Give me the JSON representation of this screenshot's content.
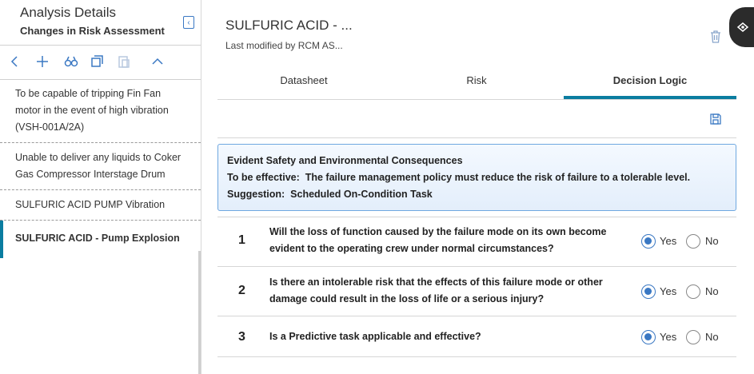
{
  "sidebar": {
    "title": "Analysis Details",
    "subtitle": "Changes in Risk Assessment",
    "items": [
      {
        "label": "To be capable of tripping Fin Fan motor in the event of high vibration (VSH-001A/2A)"
      },
      {
        "label": "Unable to deliver any liquids to Coker Gas Compressor Interstage Drum"
      },
      {
        "label": "SULFURIC ACID PUMP Vibration"
      },
      {
        "label": "SULFURIC ACID - Pump Explosion"
      }
    ]
  },
  "main": {
    "title": "SULFURIC ACID - ...",
    "subtitle": "Last modified by RCM AS...",
    "tabs": [
      {
        "label": "Datasheet"
      },
      {
        "label": "Risk"
      },
      {
        "label": "Decision Logic"
      }
    ],
    "alert": {
      "title": "Evident Safety and Environmental Consequences",
      "effective_label": "To be effective:",
      "effective_text": "The failure management policy must reduce the risk of failure to a tolerable level.",
      "suggestion_label": "Suggestion:",
      "suggestion_text": "Scheduled On-Condition Task"
    },
    "questions": [
      {
        "number": "1",
        "text": "Will the loss of function caused by the failure mode on its own become evident to the operating crew under normal circumstances?",
        "yes": "Yes",
        "no": "No",
        "selected": "Yes"
      },
      {
        "number": "2",
        "text": "Is there an intolerable risk that the effects of this failure mode or other damage could result in the loss of life or a serious injury?",
        "yes": "Yes",
        "no": "No",
        "selected": "Yes"
      },
      {
        "number": "3",
        "text": "Is a Predictive task applicable and effective?",
        "yes": "Yes",
        "no": "No",
        "selected": "Yes"
      }
    ]
  },
  "colors": {
    "accent": "#0a7da0",
    "link": "#3a78c3"
  }
}
